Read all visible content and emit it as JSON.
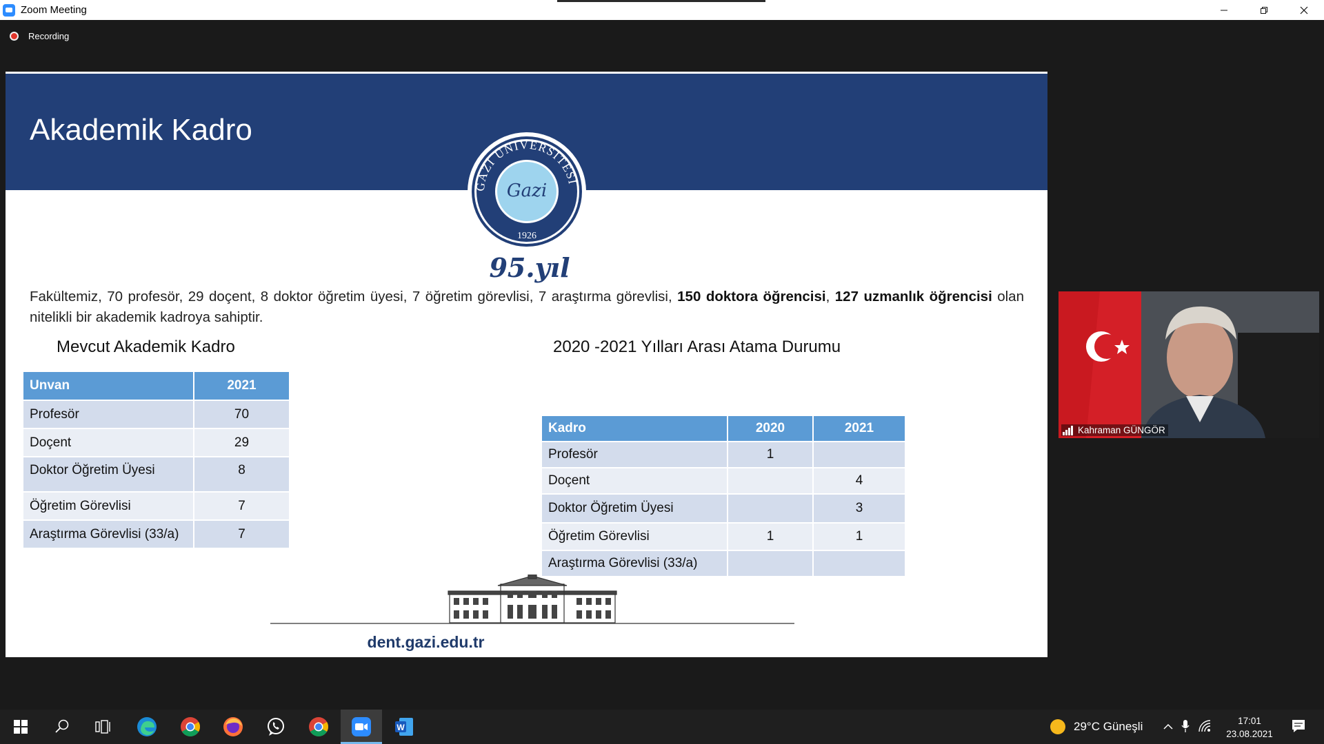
{
  "window": {
    "title": "Zoom Meeting",
    "app_icon": "zoom-icon",
    "controls": [
      "minimize-icon",
      "restore-icon",
      "close-icon"
    ]
  },
  "recording": {
    "label": "Recording"
  },
  "slide": {
    "title": "Akademik Kadro",
    "logo": {
      "ring_text": "GAZİ ÜNİVERSİTESİ",
      "center_text": "Gazi",
      "year": "1926"
    },
    "anniversary": "95.yıl",
    "intro": {
      "part1": "Fakültemiz, 70 profesör, 29 doçent, 8 doktor öğretim üyesi, 7 öğretim görevlisi, 7 araştırma görevlisi, ",
      "bold1": "150 doktora öğrencisi",
      "part2": ", ",
      "bold2": "127 uzmanlık öğrencisi",
      "part3": " olan nitelikli bir akademik kadroya sahiptir."
    },
    "left_table": {
      "heading": "Mevcut Akademik Kadro",
      "headers": [
        "Unvan",
        "2021"
      ],
      "rows": [
        [
          "Profesör",
          "70"
        ],
        [
          "Doçent",
          "29"
        ],
        [
          "Doktor Öğretim Üyesi",
          "8"
        ],
        [
          "Öğretim Görevlisi",
          "7"
        ],
        [
          "Araştırma Görevlisi (33/a)",
          "7"
        ]
      ]
    },
    "right_table": {
      "heading": "2020 -2021 Yılları Arası Atama Durumu",
      "headers": [
        "Kadro",
        "2020",
        "2021"
      ],
      "rows": [
        [
          "Profesör",
          "1",
          ""
        ],
        [
          "Doçent",
          "",
          "4"
        ],
        [
          "Doktor Öğretim Üyesi",
          "",
          "3"
        ],
        [
          "Öğretim Görevlisi",
          "1",
          "1"
        ],
        [
          "Araştırma Görevlisi (33/a)",
          "",
          ""
        ]
      ]
    },
    "website": "dent.gazi.edu.tr"
  },
  "participant": {
    "name": "Kahraman GÜNGÖR",
    "signal_icon": "signal-bars-icon"
  },
  "taskbar": {
    "apps": [
      "windows-start-icon",
      "search-icon",
      "task-view-icon",
      "edge-icon",
      "chrome-icon",
      "firefox-icon",
      "whatsapp-icon",
      "chrome-icon",
      "zoom-icon",
      "word-icon"
    ],
    "weather": "29°C  Güneşli",
    "time": "17:01",
    "date": "23.08.2021"
  },
  "colors": {
    "banner": "#223f77",
    "table_header": "#5b9bd5",
    "row_dark": "#d3dcec",
    "row_light": "#eaeef5",
    "website": "#1f3a6a"
  }
}
